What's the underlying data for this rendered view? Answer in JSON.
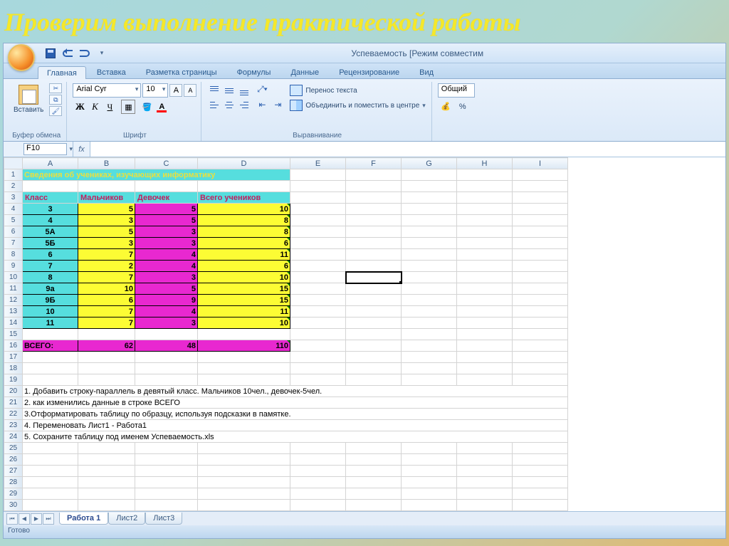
{
  "slide_title": "Проверим выполнение практической работы",
  "window_title": "Успеваемость  [Режим совместим",
  "ribbon_tabs": [
    "Главная",
    "Вставка",
    "Разметка страницы",
    "Формулы",
    "Данные",
    "Рецензирование",
    "Вид"
  ],
  "active_tab_index": 0,
  "clipboard": {
    "paste": "Вставить",
    "group_label": "Буфер обмена"
  },
  "font": {
    "name": "Arial Cyr",
    "size": "10",
    "bold": "Ж",
    "italic": "К",
    "underline": "Ч",
    "group_label": "Шрифт",
    "grow": "A",
    "shrink": "A",
    "fill_color": "#ffff00",
    "font_color": "#ff0000"
  },
  "alignment": {
    "wrap": "Перенос текста",
    "merge": "Объединить и поместить в центре",
    "group_label": "Выравнивание"
  },
  "number": {
    "format": "Общий"
  },
  "name_box": "F10",
  "fx_label": "fx",
  "columns": [
    "A",
    "B",
    "C",
    "D",
    "E",
    "F",
    "G",
    "H",
    "I"
  ],
  "sheet_title": "Сведения об учениках, изучающих информатику",
  "headers": {
    "class": "Класс",
    "boys": "Мальчиков",
    "girls": "Девочек",
    "total": "Всего учеников"
  },
  "rows": [
    {
      "r": 4,
      "class": "3",
      "boys": 5,
      "girls": 5,
      "total": 10
    },
    {
      "r": 5,
      "class": "4",
      "boys": 3,
      "girls": 5,
      "total": 8
    },
    {
      "r": 6,
      "class": "5А",
      "boys": 5,
      "girls": 3,
      "total": 8
    },
    {
      "r": 7,
      "class": "5Б",
      "boys": 3,
      "girls": 3,
      "total": 6
    },
    {
      "r": 8,
      "class": "6",
      "boys": 7,
      "girls": 4,
      "total": 11
    },
    {
      "r": 9,
      "class": "7",
      "boys": 2,
      "girls": 4,
      "total": 6
    },
    {
      "r": 10,
      "class": "8",
      "boys": 7,
      "girls": 3,
      "total": 10
    },
    {
      "r": 11,
      "class": "9а",
      "boys": 10,
      "girls": 5,
      "total": 15
    },
    {
      "r": 12,
      "class": "9Б",
      "boys": 6,
      "girls": 9,
      "total": 15
    },
    {
      "r": 13,
      "class": "10",
      "boys": 7,
      "girls": 4,
      "total": 11
    },
    {
      "r": 14,
      "class": "11",
      "boys": 7,
      "girls": 3,
      "total": 10
    }
  ],
  "totals": {
    "label": "ВСЕГО:",
    "boys": 62,
    "girls": 48,
    "total": 110,
    "row": 16
  },
  "instructions": [
    {
      "r": 20,
      "t": "1. Добавить строку-параллель в девятый  класс. Мальчиков 10чел., девочек-5чел."
    },
    {
      "r": 21,
      "t": "2. как изменились данные в строке ВСЕГО"
    },
    {
      "r": 22,
      "t": "3.Отформатировать таблицу по образцу, используя подсказки в памятке."
    },
    {
      "r": 23,
      "t": "4. Переменовать Лист1 -  Работа1"
    },
    {
      "r": 24,
      "t": "5.  Сохраните таблицу под именем Успеваемость.xls"
    }
  ],
  "empty_rows": [
    2,
    15,
    17,
    18,
    19,
    25,
    26,
    27,
    28,
    29,
    30
  ],
  "sheet_tabs": [
    "Работа 1",
    "Лист2",
    "Лист3"
  ],
  "active_sheet": 0,
  "status_text": "Готово",
  "selected_cell": "F10"
}
